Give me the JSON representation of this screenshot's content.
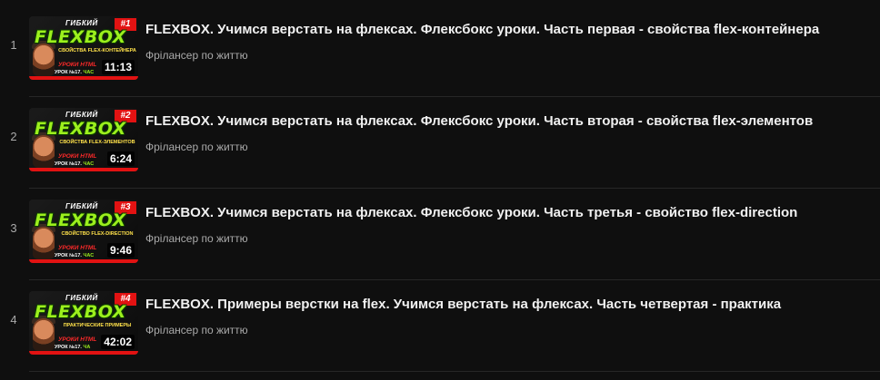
{
  "playlist": {
    "items": [
      {
        "index": "1",
        "title": "FLEXBOX. Учимся верстать на флексах. Флексбокс уроки. Часть первая - свойства flex-контейнера",
        "channel": "Фрілансер по життю",
        "duration": "11:13",
        "thumb": {
          "top": "ГИБКИЙ",
          "big": "FLEXBOX",
          "num": "#1",
          "sub": "СВОЙСТВА FLEX-КОНТЕЙНЕРА",
          "lessons": "УРОКИ HTML",
          "lesson": "УРОК №17.",
          "part": "ЧАС"
        }
      },
      {
        "index": "2",
        "title": "FLEXBOX. Учимся верстать на флексах. Флексбокс уроки. Часть вторая - свойства flex-элементов",
        "channel": "Фрілансер по життю",
        "duration": "6:24",
        "thumb": {
          "top": "ГИБКИЙ",
          "big": "FLEXBOX",
          "num": "#2",
          "sub": "СВОЙСТВА FLEX-ЭЛЕМЕНТОВ",
          "lessons": "УРОКИ HTML",
          "lesson": "УРОК №17.",
          "part": "ЧАС"
        }
      },
      {
        "index": "3",
        "title": "FLEXBOX. Учимся верстать на флексах. Флексбокс уроки. Часть третья - свойство flex-direction",
        "channel": "Фрілансер по життю",
        "duration": "9:46",
        "thumb": {
          "top": "ГИБКИЙ",
          "big": "FLEXBOX",
          "num": "#3",
          "sub": "СВОЙСТВО FLEX-DIRECTION",
          "lessons": "УРОКИ HTML",
          "lesson": "УРОК №17.",
          "part": "ЧАС"
        }
      },
      {
        "index": "4",
        "title": "FLEXBOX. Примеры верстки на flex. Учимся верстать на флексах. Часть четвертая - практика",
        "channel": "Фрілансер по життю",
        "duration": "42:02",
        "thumb": {
          "top": "ГИБКИЙ",
          "big": "FLEXBOX",
          "num": "#4",
          "sub": "ПРАКТИЧЕСКИЕ ПРИМЕРЫ",
          "lessons": "УРОКИ HTML",
          "lesson": "УРОК №17.",
          "part": "ЧА"
        }
      }
    ]
  }
}
